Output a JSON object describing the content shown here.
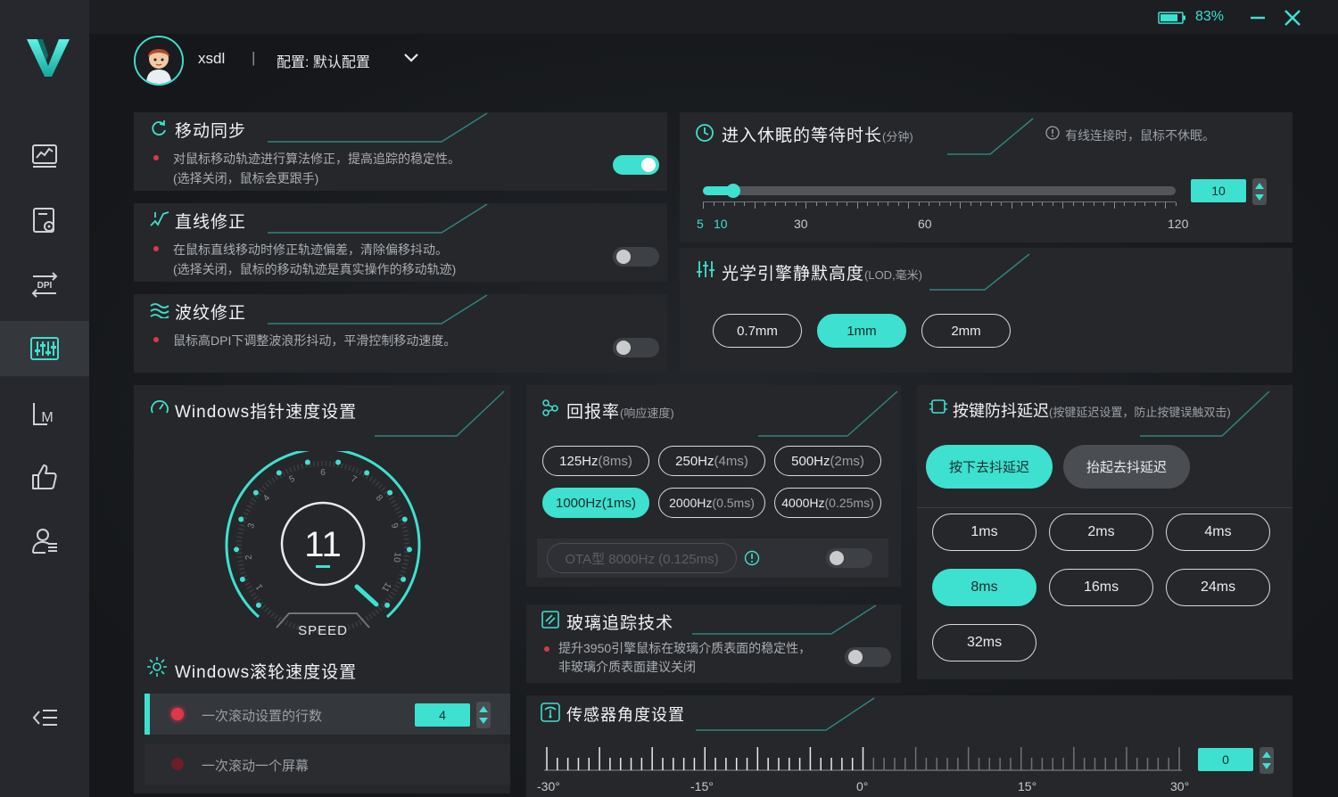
{
  "window": {
    "battery_percent": "83%",
    "battery_level": 0.83,
    "minimize_icon": "minimize-icon",
    "close_icon": "close-icon"
  },
  "colors": {
    "accent": "#3ee0cf",
    "dot_red": "#e0364a",
    "panel": "#25272b",
    "sidebar": "#26282d"
  },
  "sidebar": {
    "logo": "v-logo-icon",
    "items": [
      {
        "icon": "performance-chart-icon",
        "active": false
      },
      {
        "icon": "macro-settings-icon",
        "active": false
      },
      {
        "icon": "dpi-icon",
        "label": "DPI",
        "active": false
      },
      {
        "icon": "equalizer-icon",
        "active": true
      },
      {
        "icon": "macro-m-icon",
        "label": "M",
        "active": false
      },
      {
        "icon": "thumbs-up-icon",
        "active": false
      },
      {
        "icon": "user-settings-icon",
        "active": false
      }
    ],
    "collapse_icon": "collapse-menu-icon"
  },
  "header": {
    "username": "xsdl",
    "separator": "|",
    "profile": "配置: 默认配置",
    "dropdown_icon": "chevron-down-icon"
  },
  "motion_sync": {
    "title": "移动同步",
    "desc1": "对鼠标移动轨迹进行算法修正，提高追踪的稳定性。",
    "desc2": "(选择关闭，鼠标会更跟手)",
    "enabled": true
  },
  "line_correction": {
    "title": "直线修正",
    "desc1": "在鼠标直线移动时修正轨迹偏差，清除偏移抖动。",
    "desc2": "(选择关闭，鼠标的移动轨迹是真实操作的移动轨迹)",
    "enabled": false
  },
  "ripple_correction": {
    "title": "波纹修正",
    "desc1": "鼠标高DPI下调整波浪形抖动，平滑控制移动速度。",
    "enabled": false
  },
  "sleep": {
    "title": "进入休眠的等待时长",
    "unit": "(分钟)",
    "note": "有线连接时，鼠标不休眠。",
    "value": "10",
    "slider_value": 10,
    "min": 5,
    "max": 120,
    "ticks": [
      "5",
      "10",
      "30",
      "60",
      "120"
    ]
  },
  "lod": {
    "title": "光学引擎静默高度",
    "unit": "(LOD,毫米)",
    "options": [
      "0.7mm",
      "1mm",
      "2mm"
    ],
    "selected": "1mm"
  },
  "pointer_speed": {
    "title": "Windows指针速度设置",
    "value": "11",
    "speed_label": "SPEED",
    "dial_numbers": [
      "1",
      "2",
      "3",
      "4",
      "5",
      "6",
      "7",
      "8",
      "9",
      "10",
      "11"
    ]
  },
  "scroll_speed": {
    "title": "Windows滚轮速度设置",
    "option1": "一次滚动设置的行数",
    "value": "4",
    "option2": "一次滚动一个屏幕"
  },
  "polling": {
    "title": "回报率",
    "subtitle": "(响应速度)",
    "options": [
      {
        "hz": "125Hz",
        "ms": "(8ms)"
      },
      {
        "hz": "250Hz",
        "ms": "(4ms)"
      },
      {
        "hz": "500Hz",
        "ms": "(2ms)"
      },
      {
        "hz": "1000Hz",
        "ms": "(1ms)"
      },
      {
        "hz": "2000Hz",
        "ms": "(0.5ms)"
      },
      {
        "hz": "4000Hz",
        "ms": "(0.25ms)"
      }
    ],
    "selected": "1000Hz",
    "ota_label": "OTA型 8000Hz (0.125ms)",
    "ota_enabled": false
  },
  "glass": {
    "title": "玻璃追踪技术",
    "desc1": "提升3950引擎鼠标在玻璃介质表面的稳定性，",
    "desc2": "非玻璃介质表面建议关闭",
    "enabled": false
  },
  "debounce": {
    "title": "按键防抖延迟",
    "subtitle": "(按键延迟设置，防止按键误触双击)",
    "tab_press": "按下去抖延迟",
    "tab_release": "抬起去抖延迟",
    "options": [
      "1ms",
      "2ms",
      "4ms",
      "8ms",
      "16ms",
      "24ms",
      "32ms"
    ],
    "selected": "8ms"
  },
  "sensor_angle": {
    "title": "传感器角度设置",
    "value": "0",
    "ticks": [
      "-30°",
      "-15°",
      "0°",
      "15°",
      "30°"
    ]
  }
}
